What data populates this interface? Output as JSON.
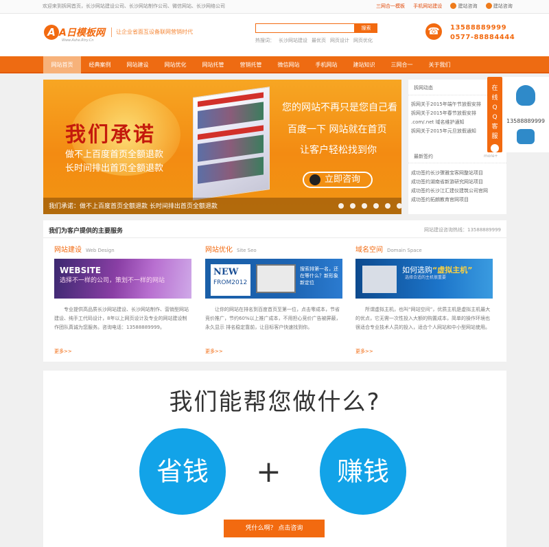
{
  "topbar": {
    "welcome": "欢迎来到拆网首页，长沙网站建设公司、长沙网站制作公司、微信网站、长沙网络公司",
    "links": [
      "三网合一模板",
      "手机网站建设",
      "建站咨询",
      "建站咨询"
    ]
  },
  "header": {
    "logo_mark": "A",
    "logo_name": "A日模板网",
    "logo_sub": "Www.Ashe.Rtry.Cn",
    "slogan": "让企业省面互设备联网营销时代",
    "search_button": "搜索",
    "search_placeholder": "",
    "hotwords_label": "热搜词：",
    "hotwords": [
      "长沙网站建设",
      "最优页",
      "网页设计",
      "网页优化"
    ],
    "phones": [
      "13588889999",
      "0577-88884444"
    ]
  },
  "nav": {
    "items": [
      "网站首页",
      "经典案例",
      "网站建设",
      "网站优化",
      "网站托管",
      "营销托管",
      "微信网站",
      "手机网站",
      "建站知识",
      "三网合一",
      "关于我们"
    ]
  },
  "banner": {
    "promise": "我们承诺",
    "sub1": "做不上百度首页全额退款",
    "sub2": "长时间排出首页全额退款",
    "headline1": "您的网站不再只是您自己看",
    "headline2": "百度一下  网站就在首页",
    "headline3": "让客户轻松找到你",
    "consult": "立即咨询",
    "caption": "我们承诺：做不上百度首页全额退款 长时间排出首页全额退款"
  },
  "news": {
    "title1": "拆网动态",
    "items1": [
      "拆网关于2015年端午节放假安排",
      "拆网关于2015年春节放假安排",
      ".com/.net 域名维护通知",
      "拆网关于2015年元旦放假通知"
    ],
    "title2": "最新签约",
    "more": "more+",
    "items2": [
      "成功签约长沙骤雅宝客网整站项目",
      "成功签约湖南省新游研究网站项目",
      "成功签约长沙江汇建仪建筑公司官网",
      "成功签约拓朗教育官网项目"
    ]
  },
  "side": {
    "tab": "在线QQ客服",
    "number": "13588889999"
  },
  "services": {
    "title": "我们为客户提供的主要服务",
    "hotline": "网站建设咨询热线：13588889999",
    "items": [
      {
        "cn": "网站建设",
        "en": "Web Design",
        "img_a": "WEBSITE",
        "img_b": "选择不一样的公司，策划不一样的网站",
        "text": "专业提供高品质长沙网站建设、长沙网站制作、营销型网站建设、纯手工代码设计，8年以上网页设计及专业的网站建设制作团队真诚为您服务。咨询电话：13588889999。",
        "more": "更多>>"
      },
      {
        "cn": "网站优化",
        "en": "Site Seo",
        "img_a": "NEW",
        "img_b": "FROM2012",
        "img_c": "搜索排第一名，还在等什么？新形象 新定位",
        "text": "让你的网站在排名到百度首页至第一位，点击零成本，节省竞价推广，节约60%以上推广成本，不用担心竞价广告被屏蔽，永久显示 排名稳定靠前，让目标客户快速找到你。",
        "more": "更多>>"
      },
      {
        "cn": "域名空间",
        "en": "Domain Space",
        "img_a": "如何选购",
        "img_b": "“虚拟主机”",
        "img_c": "选择合适的主机很重要",
        "text": "所谓虚拟主机，也叫“网站空间”，优质主机是虚拟主机最大的优点，它无需一次性投入大额的购置成本，简单的操作环境也很适合专业技术人员的投入，适合个人网站和中小型网站使用。",
        "more": "更多>>"
      }
    ]
  },
  "bottom": {
    "question": "我们能帮您做什么?",
    "left": "省钱",
    "plus": "+",
    "right": "赚钱",
    "cta": "凭什么啊？  点击咨询"
  }
}
